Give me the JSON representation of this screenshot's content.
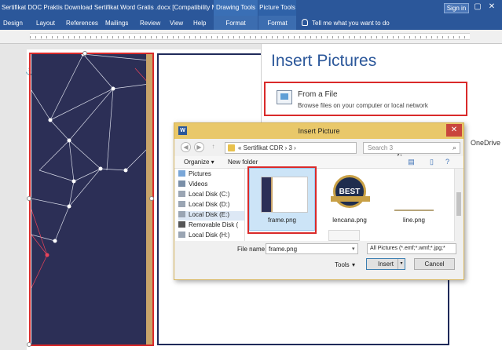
{
  "titlebar": {
    "doc_title": "Sertifikat DOC Praktis Download Sertifikat Word Gratis .docx [Compatibility Mode] -",
    "ctx_drawing": "Drawing Tools",
    "ctx_picture": "Picture Tools",
    "signin": "Sign in",
    "minimize": "–",
    "restore": "▢",
    "close": "✕"
  },
  "ribbon": {
    "tabs": [
      "Design",
      "Layout",
      "References",
      "Mailings",
      "Review",
      "View",
      "Help"
    ],
    "ctx_tabs": [
      "Format",
      "Format"
    ],
    "tellme": "Tell me what you want to do"
  },
  "insert_pictures": {
    "title": "Insert Pictures",
    "from_file_title": "From a File",
    "from_file_desc": "Browse files on your computer or local network",
    "onedrive": "OneDrive"
  },
  "dialog": {
    "title": "Insert Picture",
    "word_icon": "W",
    "close": "✕",
    "address": "« Sertifikat CDR  ›  3  ›",
    "search_placeholder": "Search 3",
    "organize": "Organize ▾",
    "new_folder": "New folder",
    "tree": [
      "Pictures",
      "Videos",
      "Local Disk (C:)",
      "Local Disk (D:)",
      "Local Disk (E:)",
      "Removable Disk (",
      "Local Disk (H:)"
    ],
    "files": [
      "frame.png",
      "lencana.png",
      "line.png"
    ],
    "badge_text": "BEST",
    "file_name_label": "File name:",
    "file_name_value": "frame.png",
    "file_type": "All Pictures (*.emf;*.wmf;*.jpg;*",
    "tools": "Tools",
    "insert": "Insert",
    "cancel": "Cancel"
  },
  "colors": {
    "word_blue": "#2b579a",
    "frame_navy": "#2c2f56",
    "gold": "#c8a46a",
    "highlight_red": "#d92a2a",
    "network_red": "#e8435a"
  }
}
